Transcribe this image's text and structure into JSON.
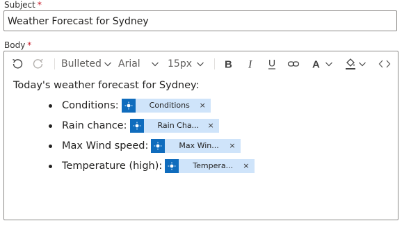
{
  "subject": {
    "label": "Subject",
    "required_mark": "*",
    "value": "Weather Forecast for Sydney"
  },
  "body": {
    "label": "Body",
    "required_mark": "*",
    "toolbar": {
      "list_style": "Bulleted",
      "font_family": "Arial",
      "font_size": "15px",
      "icons": [
        "undo-icon",
        "redo-icon",
        "bold-icon",
        "italic-icon",
        "underline-icon",
        "link-icon",
        "font-color-icon",
        "highlight-icon",
        "code-view-icon"
      ]
    },
    "intro": "Today's weather forecast for Sydney:",
    "items": [
      {
        "label": "Conditions:",
        "token": "Conditions",
        "close": "×"
      },
      {
        "label": "Rain chance:",
        "token": "Rain Cha...",
        "close": "×"
      },
      {
        "label": "Max Wind speed:",
        "token": "Max Win...",
        "close": "×"
      },
      {
        "label": "Temperature (high):",
        "token": "Tempera...",
        "close": "×"
      }
    ]
  },
  "colors": {
    "token_icon": "#0f6cbd",
    "token_bg": "#cfe4fa",
    "required": "#c50f1f",
    "border": "#8a8886"
  }
}
